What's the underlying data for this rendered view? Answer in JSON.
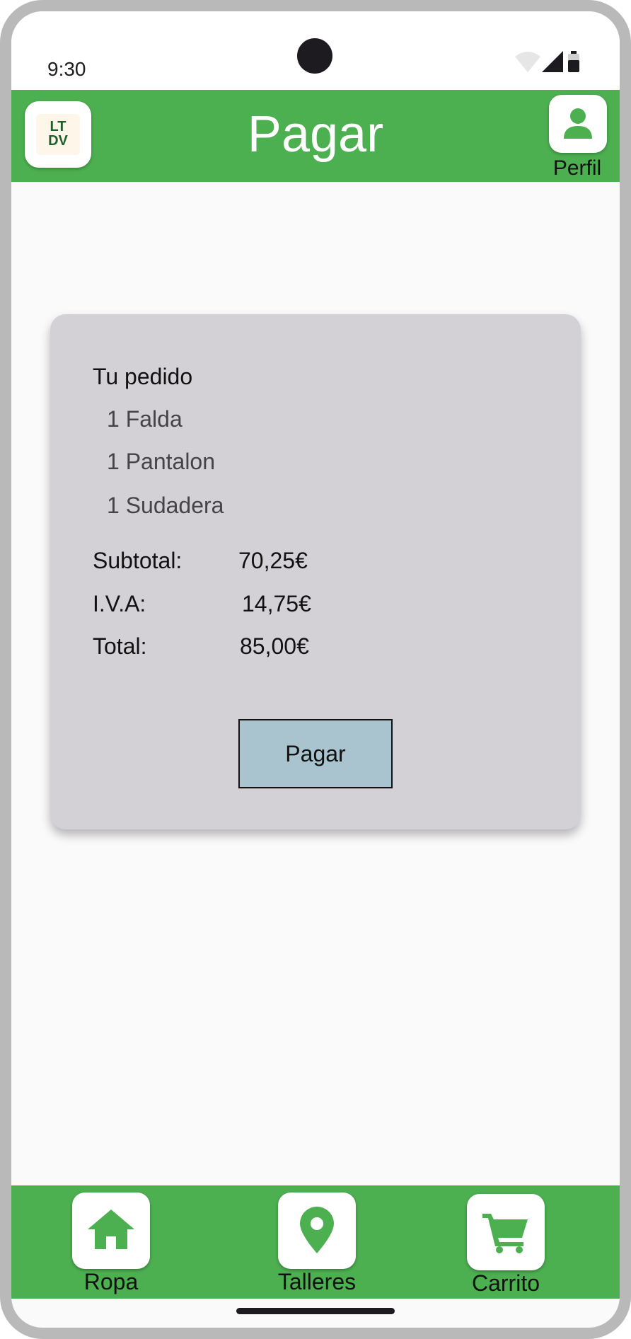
{
  "status_bar": {
    "time": "9:30"
  },
  "app_bar": {
    "logo_text_line1": "LT",
    "logo_text_line2": "DV",
    "title": "Pagar",
    "profile_label": "Perfil"
  },
  "order": {
    "title": "Tu pedido",
    "items": [
      "1 Falda",
      "1 Pantalon",
      "1 Sudadera"
    ],
    "subtotal_label": "Subtotal:",
    "subtotal_value": "70,25€",
    "iva_label": "I.V.A:",
    "iva_value": "14,75€",
    "total_label": "Total:",
    "total_value": "85,00€",
    "pay_button_label": "Pagar"
  },
  "bottom_nav": {
    "items": [
      {
        "label": "Ropa",
        "icon": "home-icon"
      },
      {
        "label": "Talleres",
        "icon": "location-pin-icon"
      },
      {
        "label": "Carrito",
        "icon": "cart-icon"
      }
    ]
  },
  "colors": {
    "primary_green": "#4caf50",
    "card_background": "#d3d1d6",
    "pay_button": "#aac4cf"
  }
}
